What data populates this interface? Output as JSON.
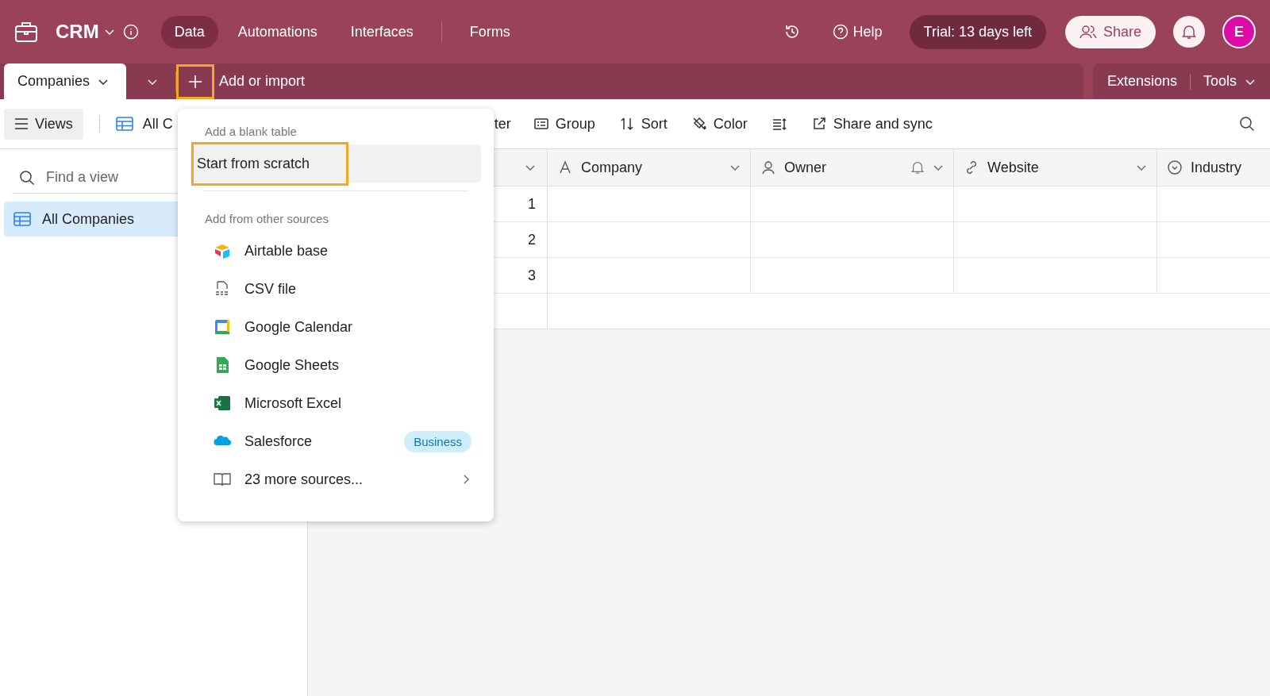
{
  "app": {
    "base_name": "CRM",
    "nav": [
      {
        "label": "Data",
        "selected": true
      },
      {
        "label": "Automations",
        "selected": false
      },
      {
        "label": "Interfaces",
        "selected": false
      },
      {
        "label": "Forms",
        "selected": false
      }
    ],
    "help": "Help",
    "trial": "Trial: 13 days left",
    "share": "Share",
    "avatar": "E"
  },
  "table_tabs": {
    "tabs": [
      {
        "label": "Companies",
        "selected": true
      }
    ],
    "add": {
      "label": "Add or import",
      "highlighted": true
    },
    "extensions": "Extensions",
    "tools": "Tools"
  },
  "toolbar": {
    "views": "Views",
    "current_view": "All C",
    "filter_fragment": "ter",
    "buttons": [
      {
        "kind": "group",
        "label": "Group"
      },
      {
        "kind": "sort",
        "label": "Sort"
      },
      {
        "kind": "color",
        "label": "Color"
      },
      {
        "kind": "row-height"
      },
      {
        "kind": "share",
        "label": "Share and sync"
      }
    ]
  },
  "sidebar": {
    "search": {
      "placeholder": "Find a view"
    },
    "views": [
      {
        "label": "All Companies",
        "selected": true
      }
    ]
  },
  "table": {
    "columns": [
      {
        "kind": "text",
        "label": "Company"
      },
      {
        "kind": "user",
        "label": "Owner"
      },
      {
        "kind": "link",
        "label": "Website"
      },
      {
        "kind": "select",
        "label": "Industry"
      }
    ],
    "rows": [
      "1",
      "2",
      "3"
    ]
  },
  "menu": {
    "sections": [
      {
        "heading": "Add a blank table",
        "items": [
          {
            "kind": "blank",
            "label": "Start from scratch",
            "hovered": true,
            "highlighted": true
          }
        ]
      },
      {
        "heading": "Add from other sources",
        "items": [
          {
            "kind": "airtable",
            "label": "Airtable base"
          },
          {
            "kind": "csv",
            "label": "CSV file"
          },
          {
            "kind": "gcal",
            "label": "Google Calendar"
          },
          {
            "kind": "gsheets",
            "label": "Google Sheets"
          },
          {
            "kind": "excel",
            "label": "Microsoft Excel"
          },
          {
            "kind": "salesforce",
            "label": "Salesforce",
            "badge": "Business"
          },
          {
            "kind": "more",
            "label": "23 more sources..."
          }
        ]
      }
    ]
  }
}
